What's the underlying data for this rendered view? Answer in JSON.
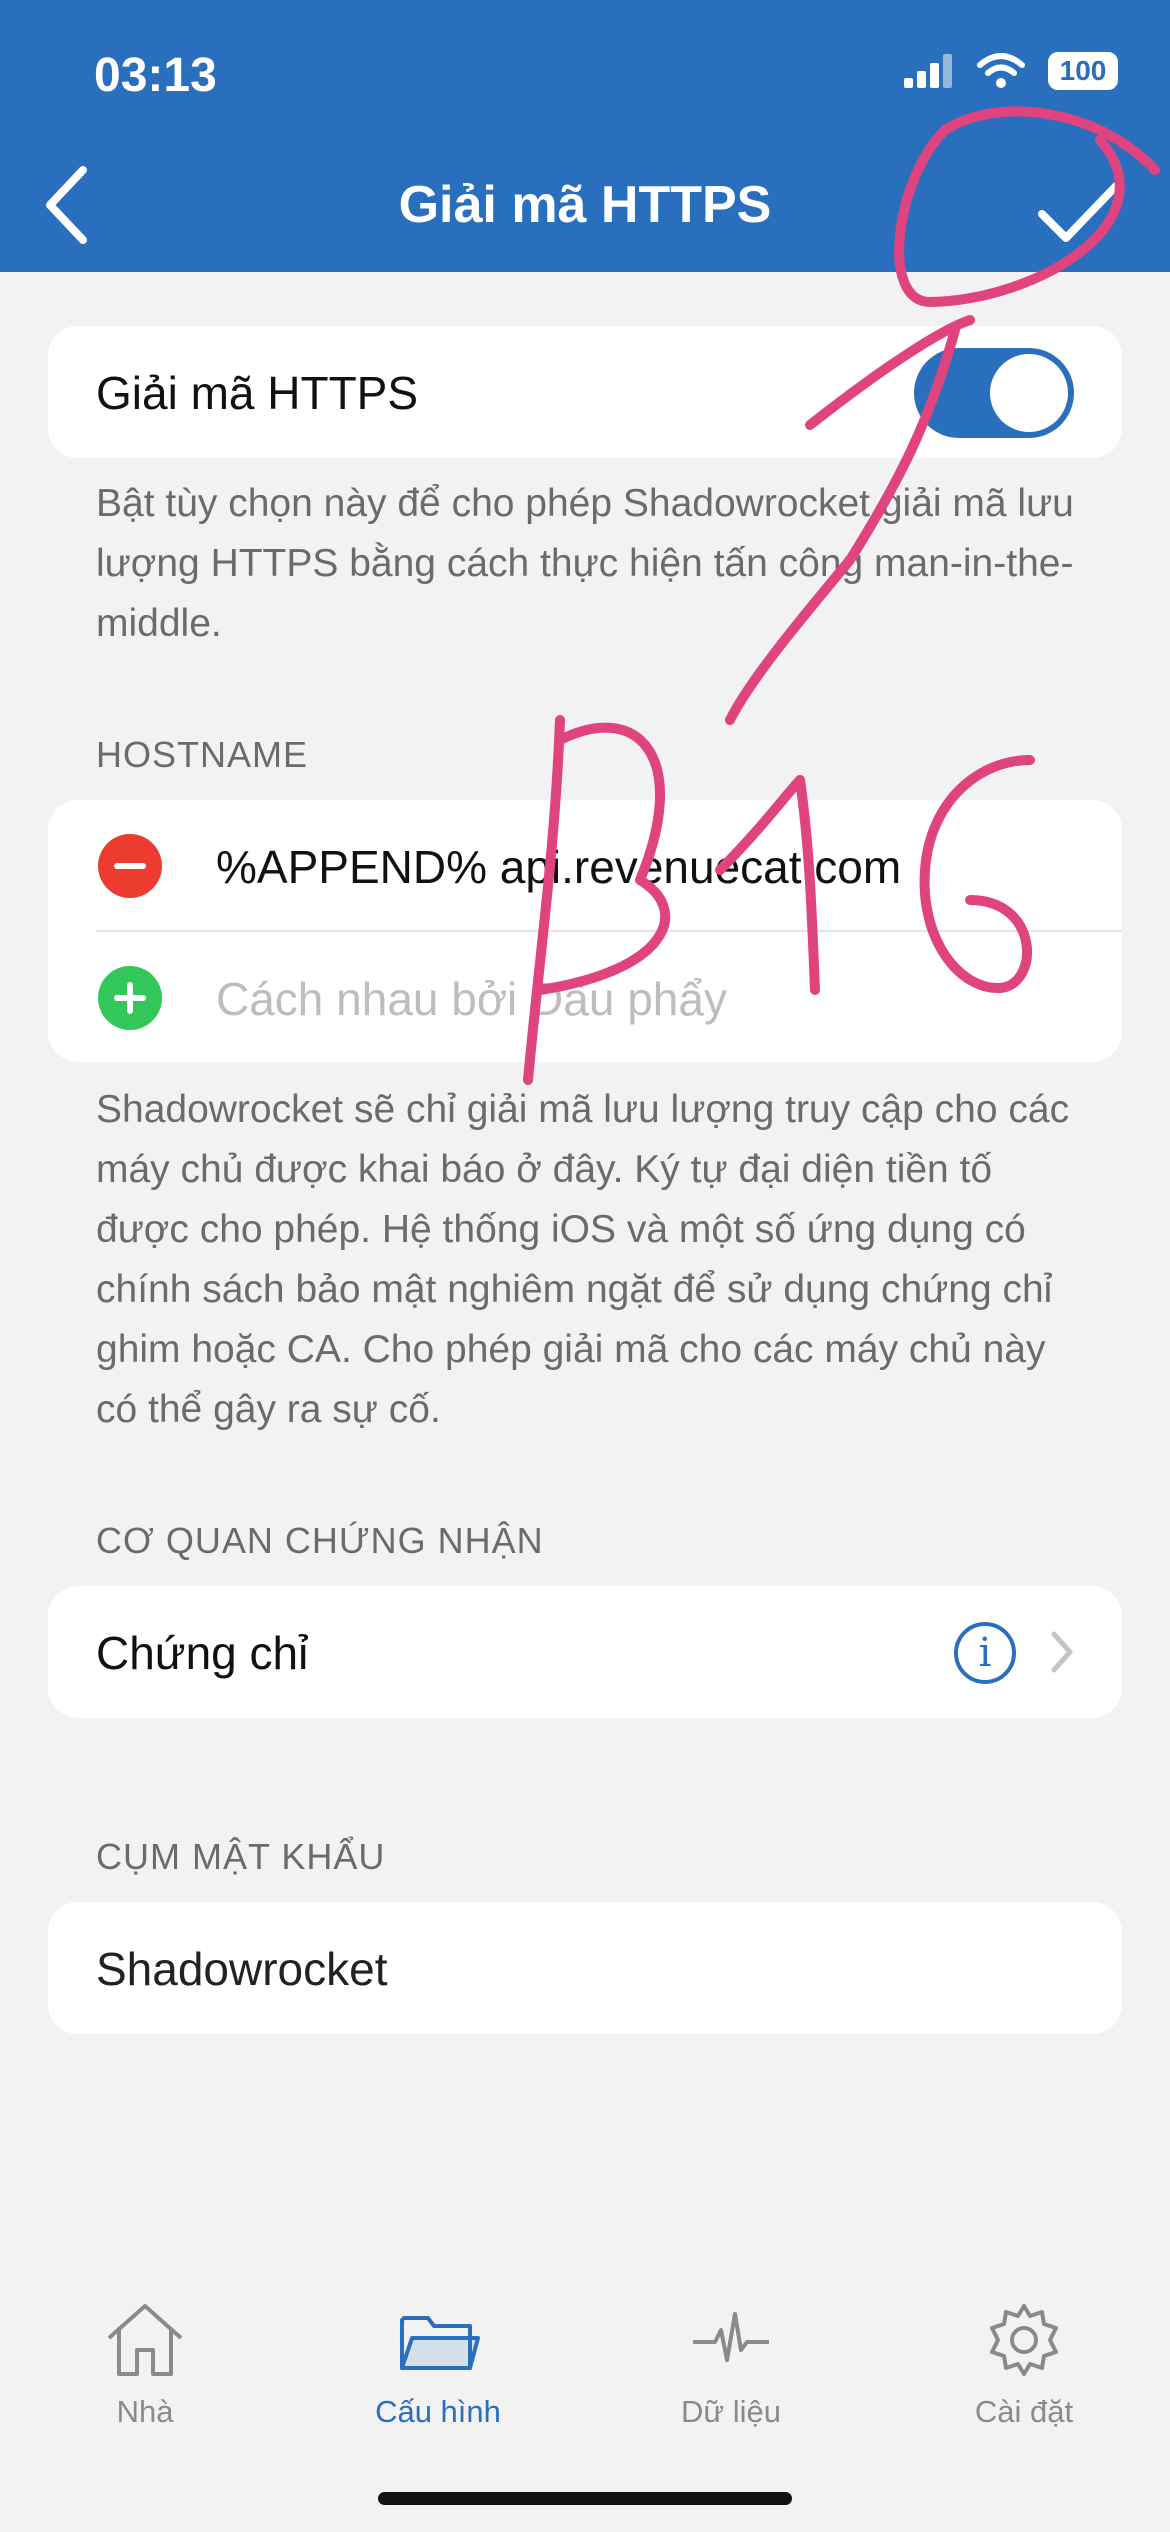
{
  "status": {
    "time": "03:13",
    "battery": "100"
  },
  "nav": {
    "title": "Giải mã HTTPS"
  },
  "https_toggle": {
    "label": "Giải mã HTTPS",
    "enabled": true
  },
  "https_description": "Bật tùy chọn này để cho phép Shadowrocket giải mã lưu lượng HTTPS bằng cách thực hiện tấn công man-in-the-middle.",
  "hostname": {
    "header": "HOSTNAME",
    "entries": [
      "%APPEND% api.revenuecat.com"
    ],
    "placeholder": "Cách nhau bởi Dấu phẩy",
    "description": "Shadowrocket sẽ chỉ giải mã lưu lượng truy cập cho các máy chủ được khai báo ở đây. Ký tự đại diện tiền tố được cho phép. Hệ thống iOS và một số ứng dụng có chính sách bảo mật nghiêm ngặt để sử dụng chứng chỉ ghim hoặc CA. Cho phép giải mã cho các máy chủ này có thể gây ra sự cố."
  },
  "certificate": {
    "header": "CƠ QUAN CHỨNG NHẬN",
    "label": "Chứng chỉ"
  },
  "passphrase": {
    "header": "CỤM MẬT KHẨU",
    "value": "Shadowrocket"
  },
  "annotation": {
    "text": "B16",
    "color": "#e0447e"
  },
  "tabs": [
    {
      "label": "Nhà",
      "icon": "home-icon",
      "active": false
    },
    {
      "label": "Cấu hình",
      "icon": "folder-icon",
      "active": true
    },
    {
      "label": "Dữ liệu",
      "icon": "activity-icon",
      "active": false
    },
    {
      "label": "Cài đặt",
      "icon": "gear-icon",
      "active": false
    }
  ],
  "colors": {
    "accent": "#2a6fbd",
    "remove": "#ee3b30",
    "add": "#33c659",
    "background": "#f2f2f2"
  }
}
